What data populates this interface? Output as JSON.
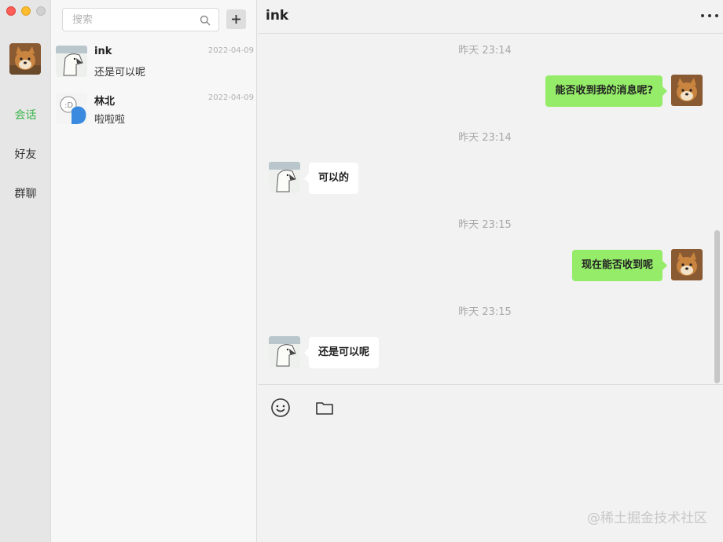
{
  "window": {
    "traffic_lights": [
      "close",
      "minimize",
      "zoom"
    ]
  },
  "nav": {
    "items": [
      {
        "label": "会话",
        "active": true
      },
      {
        "label": "好友",
        "active": false
      },
      {
        "label": "群聊",
        "active": false
      }
    ],
    "accent_color": "#3ab54a"
  },
  "search": {
    "placeholder": "搜索",
    "value": "",
    "icon": "search-icon",
    "add_icon": "plus-icon"
  },
  "conversations": [
    {
      "name": "ink",
      "date": "2022-04-09",
      "preview": "还是可以呢",
      "avatar": "bird-avatar"
    },
    {
      "name": "林北",
      "date": "2022-04-09",
      "preview": "啦啦啦",
      "avatar": "blue-avatar"
    }
  ],
  "chat": {
    "title": "ink",
    "more_icon": "more-dots-icon",
    "messages": [
      {
        "time": "昨天 23:14",
        "direction": "out",
        "text": "能否收到我的消息呢?"
      },
      {
        "time": "昨天 23:14",
        "direction": "in",
        "text": "可以的"
      },
      {
        "time": "昨天 23:15",
        "direction": "out",
        "text": "现在能否收到呢"
      },
      {
        "time": "昨天 23:15",
        "direction": "in",
        "text": "还是可以呢"
      }
    ],
    "bubble_out_color": "#95ec69",
    "bubble_in_color": "#ffffff"
  },
  "composer": {
    "tools": [
      "emoji-icon",
      "folder-icon"
    ],
    "value": ""
  },
  "watermark": "@稀土掘金技术社区"
}
